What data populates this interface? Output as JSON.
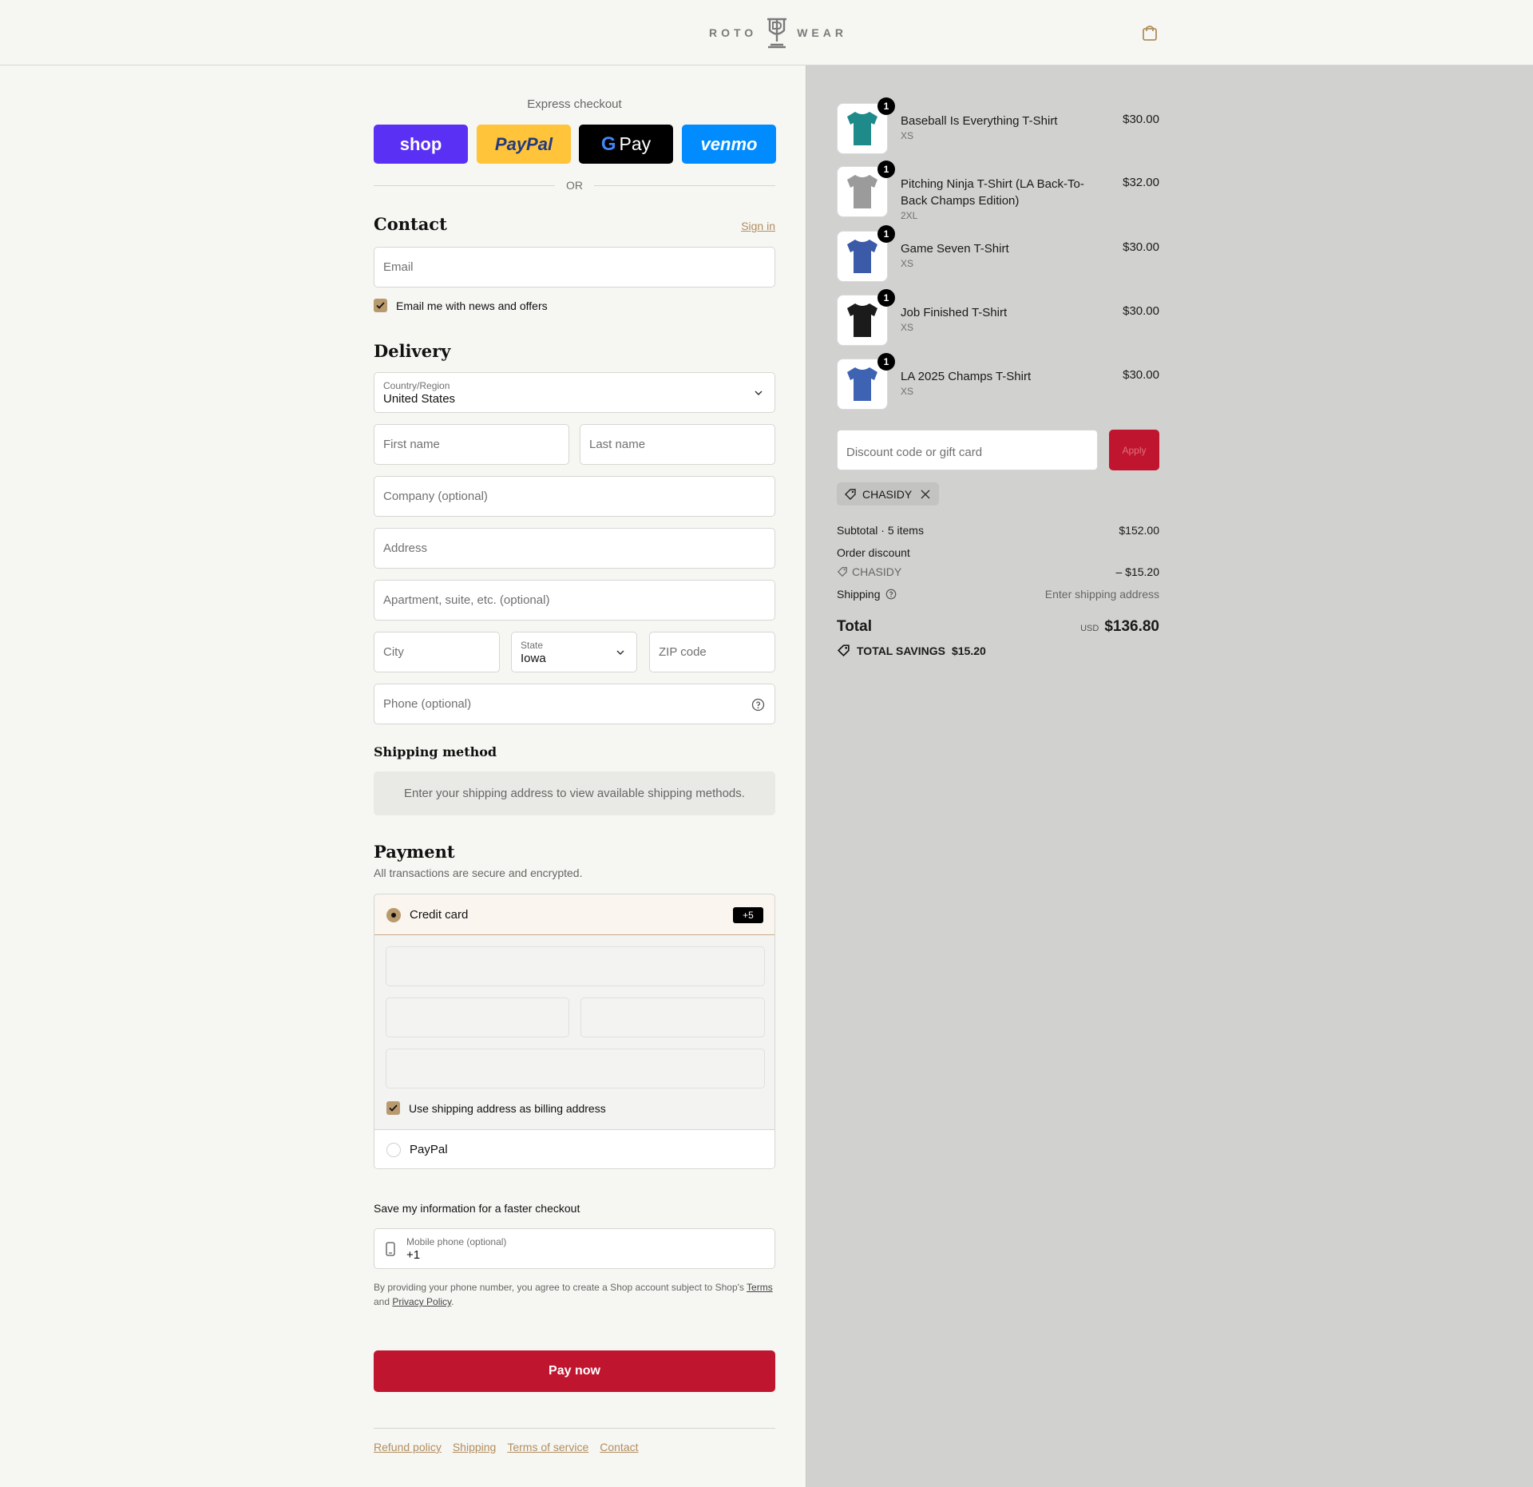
{
  "brand": {
    "left": "ROTO",
    "right": "WEAR",
    "monogram": "RW"
  },
  "express": {
    "title": "Express checkout",
    "buttons": [
      {
        "label": "shop",
        "color": "#5a31f4"
      },
      {
        "label": "PayPal",
        "color": "#ffc439"
      },
      {
        "label": "Pay",
        "color": "#000000"
      },
      {
        "label": "venmo",
        "color": "#008cff"
      }
    ],
    "or": "OR"
  },
  "contact": {
    "title": "Contact",
    "signin": "Sign in",
    "email_placeholder": "Email",
    "newsletter": "Email me with news and offers"
  },
  "delivery": {
    "title": "Delivery",
    "country_label": "Country/Region",
    "country_value": "United States",
    "first_name": "First name",
    "last_name": "Last name",
    "company": "Company (optional)",
    "address": "Address",
    "apartment": "Apartment, suite, etc. (optional)",
    "city": "City",
    "state_label": "State",
    "state_value": "Iowa",
    "zip": "ZIP code",
    "phone": "Phone (optional)"
  },
  "shipping_method": {
    "title": "Shipping method",
    "notice": "Enter your shipping address to view available shipping methods."
  },
  "payment": {
    "title": "Payment",
    "subtitle": "All transactions are secure and encrypted.",
    "credit_card": "Credit card",
    "more_badge": "+5",
    "billing_same": "Use shipping address as billing address",
    "paypal": "PayPal"
  },
  "save_info": {
    "title": "Save my information for a faster checkout",
    "phone_label": "Mobile phone (optional)",
    "phone_value": "+1",
    "legal_prefix": "By providing your phone number, you agree to create a Shop account subject to Shop's ",
    "terms": "Terms",
    "and": "and ",
    "privacy": "Privacy Policy",
    "period": "."
  },
  "pay_button": "Pay now",
  "footer": {
    "links": [
      "Refund policy",
      "Shipping",
      "Terms of service",
      "Contact"
    ]
  },
  "accent": "#c0152f",
  "items": [
    {
      "name": "Baseball Is Everything T-Shirt",
      "variant": "XS",
      "price": "$30.00",
      "qty": "1",
      "color": "#1e8a8a"
    },
    {
      "name": "Pitching Ninja T-Shirt (LA Back-To-Back Champs Edition)",
      "variant": "2XL",
      "price": "$32.00",
      "qty": "1",
      "color": "#9b9b9b"
    },
    {
      "name": "Game Seven T-Shirt",
      "variant": "XS",
      "price": "$30.00",
      "qty": "1",
      "color": "#3b5aa8"
    },
    {
      "name": "Job Finished T-Shirt",
      "variant": "XS",
      "price": "$30.00",
      "qty": "1",
      "color": "#1b1b1b"
    },
    {
      "name": "LA 2025 Champs T-Shirt",
      "variant": "XS",
      "price": "$30.00",
      "qty": "1",
      "color": "#3e63b3"
    }
  ],
  "discount": {
    "placeholder": "Discount code or gift card",
    "apply": "Apply",
    "code": "CHASIDY"
  },
  "summary": {
    "subtotal_label": "Subtotal · 5 items",
    "subtotal_value": "$152.00",
    "order_discount": "Order discount",
    "discount_code": "CHASIDY",
    "discount_value": "– $15.20",
    "shipping_label": "Shipping",
    "shipping_value": "Enter shipping address",
    "total_label": "Total",
    "currency": "USD",
    "total_value": "$136.80",
    "savings_label": "TOTAL SAVINGS",
    "savings_value": "$15.20"
  }
}
